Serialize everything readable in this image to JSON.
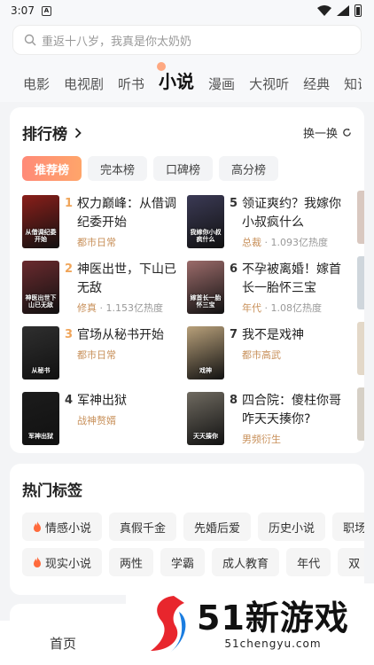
{
  "status": {
    "time": "3:07"
  },
  "search": {
    "placeholder": "重返十八岁，我真是你太奶奶"
  },
  "categories": [
    "电影",
    "电视剧",
    "听书",
    "小说",
    "漫画",
    "大视听",
    "经典",
    "知识"
  ],
  "active_category": "小说",
  "ranking": {
    "title": "排行榜",
    "swap": "换一换",
    "tabs": [
      "推荐榜",
      "完本榜",
      "口碑榜",
      "高分榜"
    ],
    "items": [
      {
        "rank": "1",
        "title": "权力巅峰：从借调纪委开始",
        "tag": "都市日常",
        "heat": "",
        "cover_text": "从借调纪委开始",
        "cover_color": "#8a1f1a"
      },
      {
        "rank": "5",
        "title": "领证爽约？我嫁你小叔疯什么",
        "tag": "总裁",
        "heat": "1.093亿热度",
        "cover_text": "我嫁你小叔疯什么",
        "cover_color": "#3b3a55"
      },
      {
        "rank": "2",
        "title": "神医出世，下山已无敌",
        "tag": "修真",
        "heat": "1.153亿热度",
        "cover_text": "神医出世下山已无敌",
        "cover_color": "#6a2a2e"
      },
      {
        "rank": "6",
        "title": "不孕被离婚！嫁首长一胎怀三宝",
        "tag": "年代",
        "heat": "1.08亿热度",
        "cover_text": "嫁首长一胎怀三宝",
        "cover_color": "#9b6b6a"
      },
      {
        "rank": "3",
        "title": "官场从秘书开始",
        "tag": "都市日常",
        "heat": "",
        "cover_text": "从秘书",
        "cover_color": "#2f2f2f"
      },
      {
        "rank": "7",
        "title": "我不是戏神",
        "tag": "都市高武",
        "heat": "",
        "cover_text": "戏神",
        "cover_color": "#b8a07a"
      },
      {
        "rank": "4",
        "title": "军神出狱",
        "tag": "战神赘婿",
        "heat": "",
        "cover_text": "军神出狱",
        "cover_color": "#1c1c1c"
      },
      {
        "rank": "8",
        "title": "四合院：傻柱你哥咋天天揍你?",
        "tag": "男频衍生",
        "heat": "",
        "cover_text": "天天揍你",
        "cover_color": "#6f6a60"
      }
    ]
  },
  "hot_tags": {
    "title": "热门标签",
    "row1": [
      {
        "label": "情感小说",
        "hot": true
      },
      {
        "label": "真假千金",
        "hot": false
      },
      {
        "label": "先婚后爱",
        "hot": false
      },
      {
        "label": "历史小说",
        "hot": false
      },
      {
        "label": "职场",
        "hot": false
      }
    ],
    "row2": [
      {
        "label": "现实小说",
        "hot": true
      },
      {
        "label": "两性",
        "hot": false
      },
      {
        "label": "学霸",
        "hot": false
      },
      {
        "label": "成人教育",
        "hot": false
      },
      {
        "label": "年代",
        "hot": false
      },
      {
        "label": "双",
        "hot": false
      }
    ]
  },
  "bottom_nav": {
    "home": "首页"
  },
  "watermark": {
    "brand": "51新游戏",
    "url": "51chengyu.com"
  },
  "colors": {
    "accent": "#ff8a78",
    "rank_top3": "#f0a55a",
    "tag_text": "#c8905a"
  }
}
